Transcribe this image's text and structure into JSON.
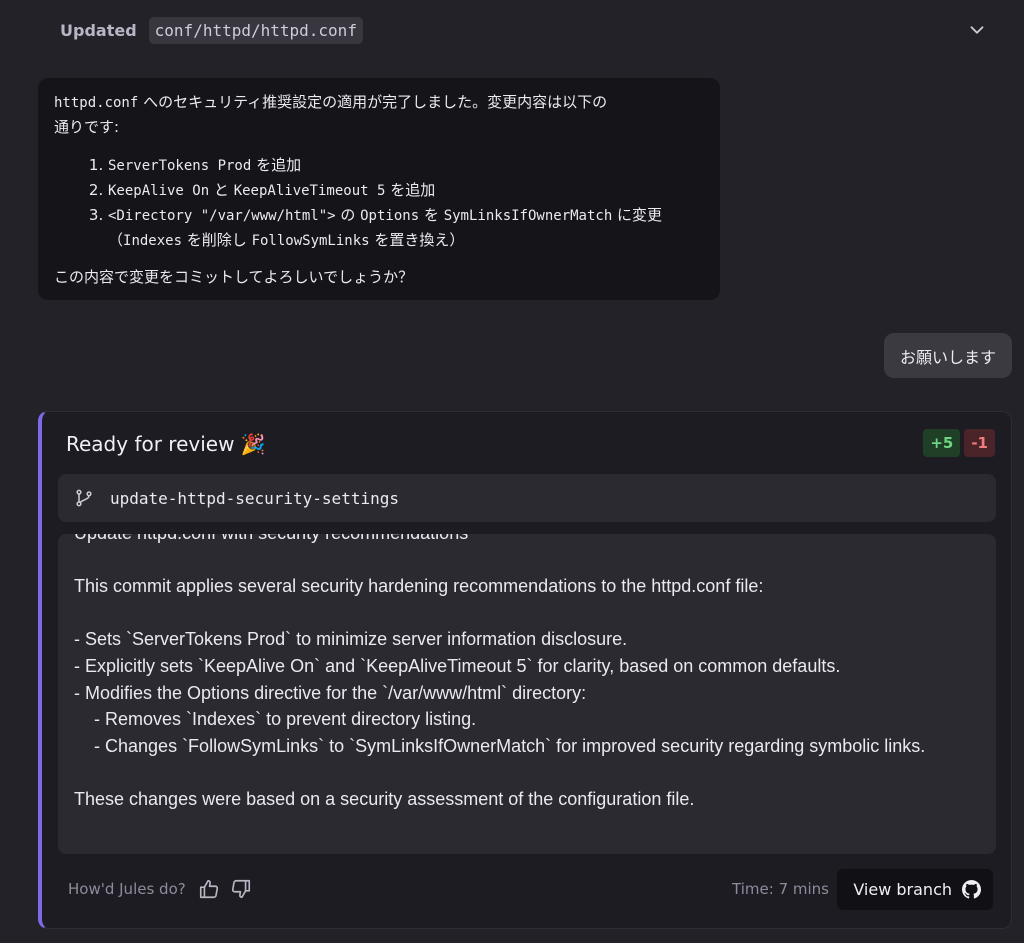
{
  "update_row": {
    "label": "Updated",
    "file_path": "conf/httpd/httpd.conf"
  },
  "assistant_message": {
    "intro_code": "httpd.conf",
    "intro_text_line1": " へのセキュリティ推奨設定の適用が完了しました。変更内容は以下の",
    "intro_text_line2": "通りです:",
    "items": [
      {
        "code1": "ServerTokens Prod",
        "text1": " を追加"
      },
      {
        "code1": "KeepAlive On",
        "text1": " と ",
        "code2": "KeepAliveTimeout 5",
        "text2": " を追加"
      },
      {
        "code1": "<Directory \"/var/www/html\">",
        "text1": " の ",
        "code2": "Options",
        "text2": " を ",
        "code3": "SymLinksIfOwnerMatch",
        "text3": " に変更",
        "line2_prefix": "（",
        "code4": "Indexes",
        "text4": " を削除し ",
        "code5": "FollowSymLinks",
        "text5": " を置き換え）"
      }
    ],
    "closing": "この内容で変更をコミットしてよろしいでしょうか？"
  },
  "user_message": "お願いします",
  "review": {
    "title": "Ready for review 🎉",
    "additions": "+5",
    "deletions": "-1",
    "branch_name": "update-httpd-security-settings",
    "commit_message": "Update httpd.conf with security recommendations\n\nThis commit applies several security hardening recommendations to the httpd.conf file:\n\n- Sets `ServerTokens Prod` to minimize server information disclosure.\n- Explicitly sets `KeepAlive On` and `KeepAliveTimeout 5` for clarity, based on common defaults.\n- Modifies the Options directive for the `/var/www/html` directory:\n    - Removes `Indexes` to prevent directory listing.\n    - Changes `FollowSymLinks` to `SymLinksIfOwnerMatch` for improved security regarding symbolic links.\n\nThese changes were based on a security assessment of the configuration file.",
    "feedback_label": "How'd Jules do?",
    "time_label": "Time: 7 mins",
    "view_branch_label": "View branch"
  },
  "icons": {
    "collapse": "chevron-down-icon",
    "branch": "git-branch-icon",
    "thumbs_up": "thumbs-up-icon",
    "thumbs_down": "thumbs-down-icon",
    "github": "github-icon"
  },
  "colors": {
    "background": "#232228",
    "accent": "#7e6ae6",
    "additions": "#6fd584",
    "deletions": "#f07d7d"
  }
}
